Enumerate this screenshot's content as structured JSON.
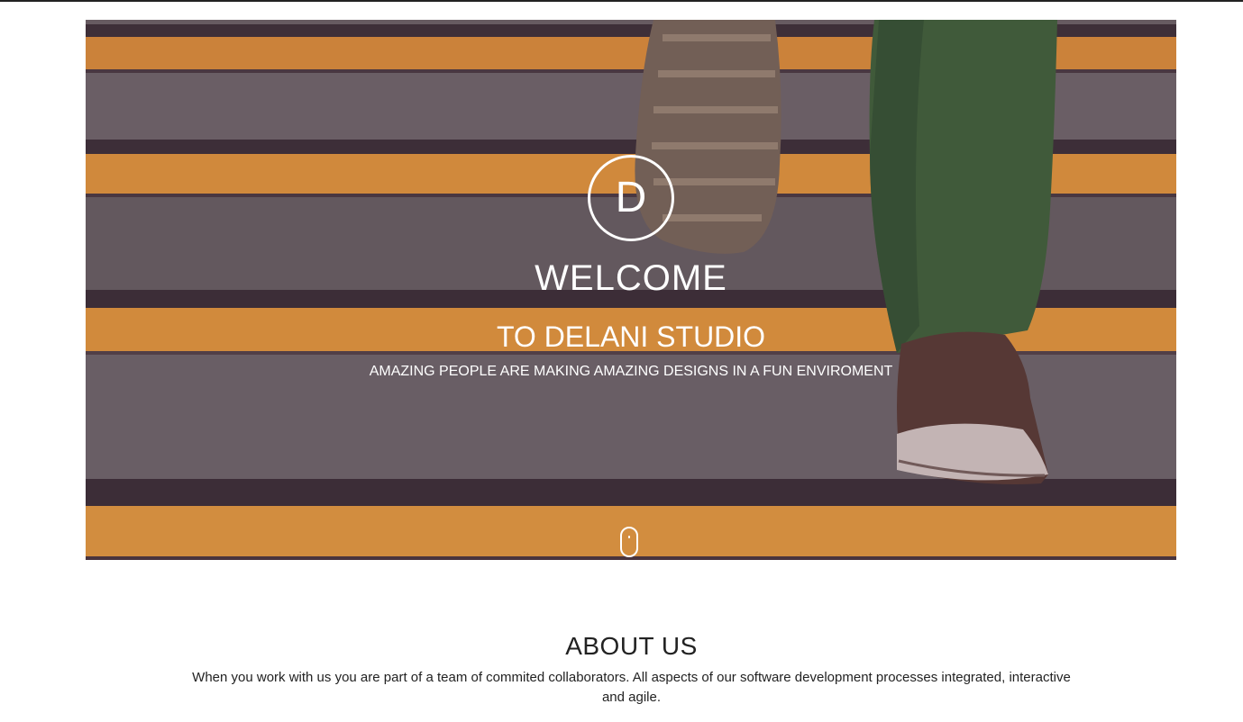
{
  "hero": {
    "logo_letter": "D",
    "title": "WELCOME",
    "subtitle": "TO DELANI STUDIO",
    "tagline": "AMAZING PEOPLE ARE MAKING AMAZING DESIGNS IN A FUN ENVIROMENT",
    "background_image": "stairs-sneaker-photo",
    "scroll_indicator_icon": "mouse-scroll-icon",
    "colors": {
      "stripe": "#f0a23a",
      "step": "#6f6c6b",
      "text": "#ffffff"
    }
  },
  "about": {
    "title": "ABOUT US",
    "text": "When you work with us you are part of a team of commited collaborators. All aspects of our software development processes integrated, interactive and agile."
  }
}
